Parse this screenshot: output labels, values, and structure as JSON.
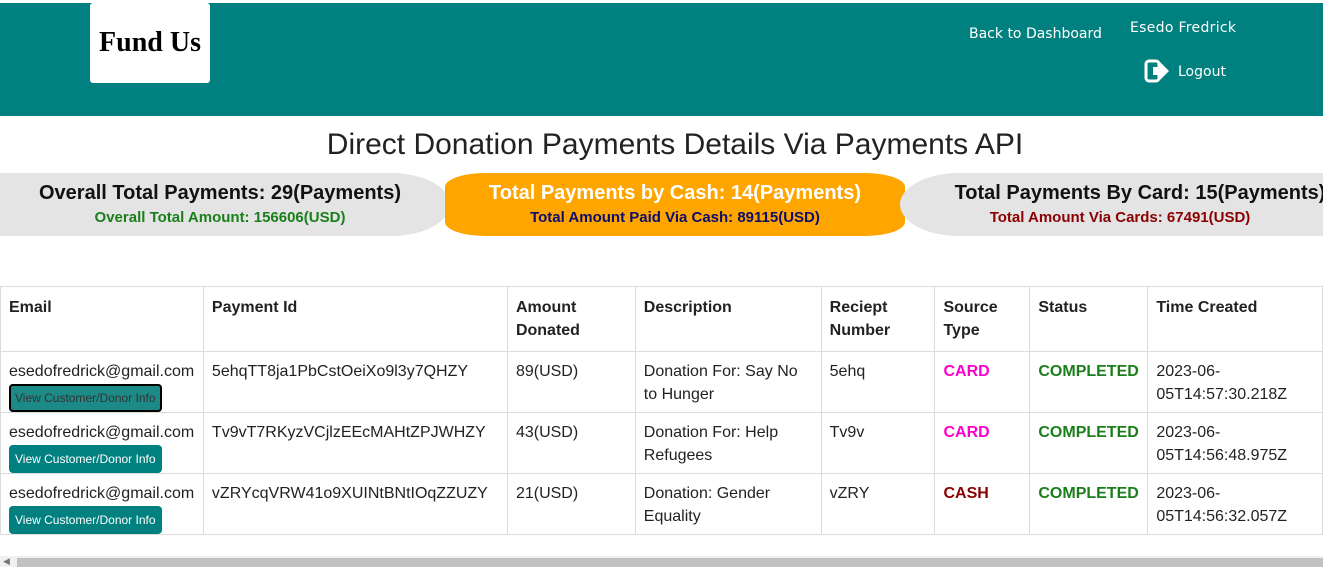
{
  "header": {
    "logo": "Fund Us",
    "back_link": "Back to Dashboard",
    "user_name": "Esedo Fredrick",
    "logout": "Logout"
  },
  "page_title": "Direct Donation Payments Details Via Payments API",
  "summary": {
    "overall": {
      "title": "Overall Total Payments: 29(Payments)",
      "sub": "Overall Total Amount: 156606(USD)"
    },
    "cash": {
      "title": "Total Payments by Cash: 14(Payments)",
      "sub": "Total Amount Paid Via Cash: 89115(USD)"
    },
    "card": {
      "title": "Total Payments By Card: 15(Payments)",
      "sub": "Total Amount Via Cards: 67491(USD)"
    }
  },
  "table": {
    "headers": [
      "Email",
      "Payment Id",
      "Amount Donated",
      "Description",
      "Reciept Number",
      "Source Type",
      "Status",
      "Time Created"
    ],
    "button_label": "View Customer/Donor Info",
    "rows": [
      {
        "email": "esedofredrick@gmail.com",
        "payment_id": "5ehqTT8ja1PbCstOeiXo9l3y7QHZY",
        "amount": "89(USD)",
        "description": "Donation For: Say No to Hunger",
        "receipt": "5ehq",
        "source": "CARD",
        "status": "COMPLETED",
        "time": "2023-06-05T14:57:30.218Z"
      },
      {
        "email": "esedofredrick@gmail.com",
        "payment_id": "Tv9vT7RKyzVCjlzEEcMAHtZPJWHZY",
        "amount": "43(USD)",
        "description": "Donation For: Help Refugees",
        "receipt": "Tv9v",
        "source": "CARD",
        "status": "COMPLETED",
        "time": "2023-06-05T14:56:48.975Z"
      },
      {
        "email": "esedofredrick@gmail.com",
        "payment_id": "vZRYcqVRW41o9XUINtBNtIOqZZUZY",
        "amount": "21(USD)",
        "description": "Donation: Gender Equality",
        "receipt": "vZRY",
        "source": "CASH",
        "status": "COMPLETED",
        "time": "2023-06-05T14:56:32.057Z"
      }
    ]
  },
  "colors": {
    "header_bg": "#00807e",
    "cash_bg": "#ffa500",
    "card_source": "#ff00cc",
    "cash_source": "#8b0000",
    "completed": "#1a7f1a"
  },
  "icons": {
    "logout": "sign-out-icon"
  }
}
